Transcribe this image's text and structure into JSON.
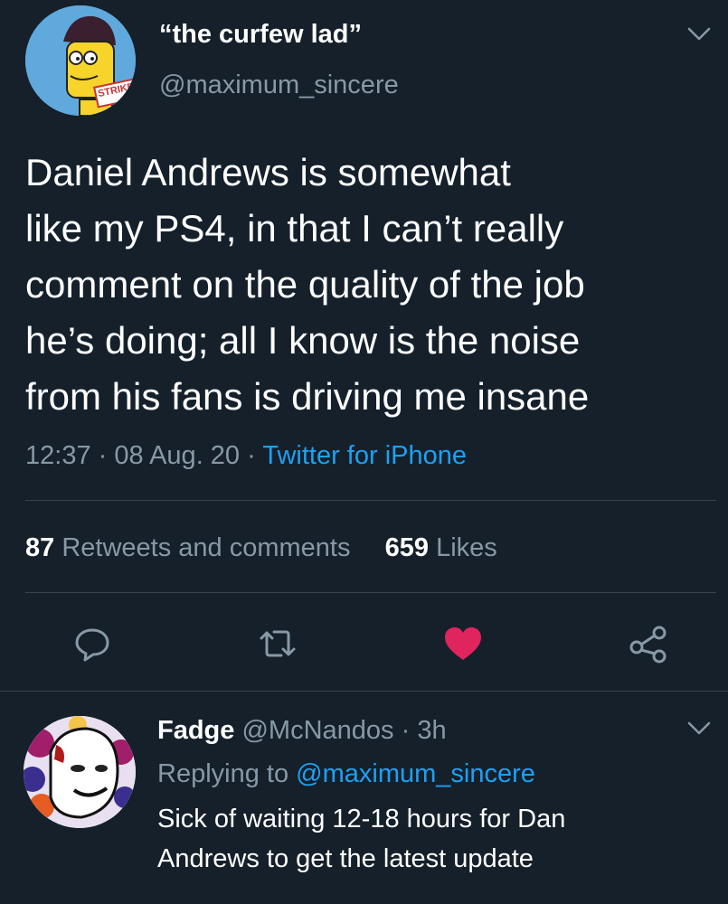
{
  "tweet": {
    "display_name": "“the curfew lad”",
    "handle": "@maximum_sincere",
    "avatar_badge": "STRIKE",
    "text_lines": [
      "Daniel Andrews is somewhat",
      "like my PS4, in that I can’t really",
      "comment on the quality of the job",
      "he’s doing; all I know is the noise",
      "from his fans is driving me insane"
    ],
    "time": "12:37",
    "date": "08 Aug. 20",
    "source": "Twitter for iPhone",
    "separator": "·",
    "retweets_count": "87",
    "retweets_label": "Retweets and comments",
    "likes_count": "659",
    "likes_label": "Likes"
  },
  "actions": {
    "reply_icon": "comment-icon",
    "retweet_icon": "retweet-icon",
    "like_icon": "heart-icon",
    "share_icon": "share-icon",
    "like_color": "#e0245e"
  },
  "reply": {
    "display_name": "Fadge",
    "handle": "@McNandos",
    "separator": "·",
    "age": "3h",
    "replying_prefix": "Replying to",
    "replying_to": "@maximum_sincere",
    "text_lines": [
      "Sick of waiting 12-18 hours for Dan",
      "Andrews to get the latest update"
    ]
  },
  "colors": {
    "background": "#15202b",
    "muted": "#8899a6",
    "accent": "#1da1f2",
    "divider": "#38444d"
  }
}
